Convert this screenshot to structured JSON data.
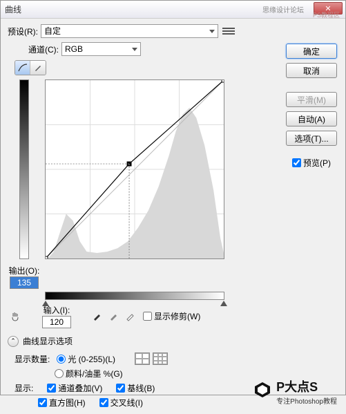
{
  "title": "曲线",
  "preset": {
    "label": "预设(R):",
    "value": "自定"
  },
  "channel": {
    "label": "通道(C):",
    "value": "RGB"
  },
  "buttons": {
    "ok": "确定",
    "cancel": "取消",
    "smooth": "平滑(M)",
    "auto": "自动(A)",
    "options": "选项(T)..."
  },
  "preview": {
    "label": "预览(P)",
    "checked": true
  },
  "output": {
    "label": "输出(O):",
    "value": "135"
  },
  "input": {
    "label": "输入(I):",
    "value": "120"
  },
  "show_clipping": {
    "label": "显示修剪(W)",
    "checked": false
  },
  "curve_options_header": "曲线显示选项",
  "display_amount": {
    "label": "显示数量:",
    "light": "光 (0-255)(L)",
    "pigment": "颜料/油墨 %(G)"
  },
  "show": {
    "label": "显示:",
    "channel_overlay": "通道叠加(V)",
    "baseline": "基线(B)",
    "histogram": "直方图(H)",
    "intersection": "交叉线(I)"
  },
  "watermark": {
    "big": "P大点S",
    "small": "专注Photoshop教程"
  },
  "topmark": "思缘设计论坛",
  "topmark2": "PS教程区",
  "chart_data": {
    "type": "line",
    "title": "Curves",
    "xlabel": "输入",
    "ylabel": "输出",
    "xlim": [
      0,
      255
    ],
    "ylim": [
      0,
      255
    ],
    "series": [
      {
        "name": "curve",
        "x": [
          0,
          120,
          255
        ],
        "y": [
          0,
          135,
          255
        ]
      }
    ],
    "grid": {
      "rows": 4,
      "cols": 4
    }
  }
}
